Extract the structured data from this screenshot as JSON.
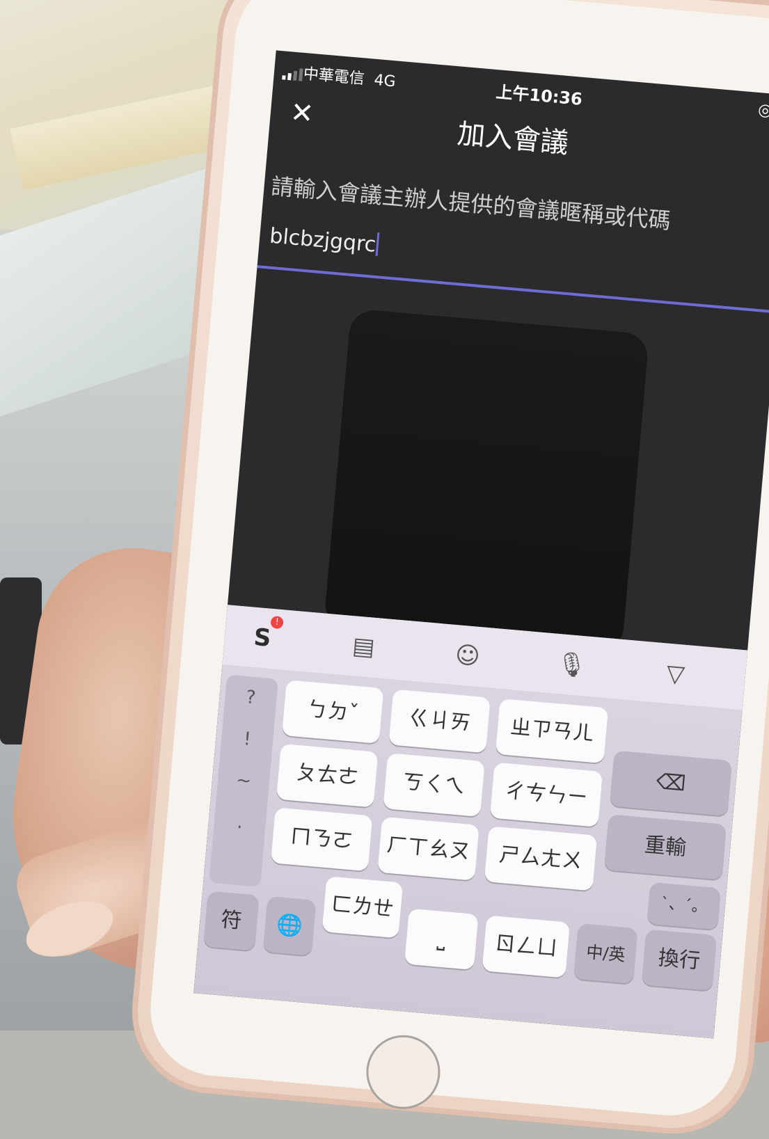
{
  "status_bar": {
    "carrier": "中華電信",
    "network": "4G",
    "time": "上午10:36",
    "right_icons": "◎ ➤"
  },
  "nav": {
    "close_icon": "✕",
    "title": "加入會議"
  },
  "prompt": "請輸入會議主辦人提供的會議暱稱或代碼",
  "meeting_code": {
    "value": "blcbzjgqrc",
    "accent_color": "#6f6cd6"
  },
  "keyboard": {
    "toolbar": {
      "sogou_label": "S",
      "sogou_badge": "!",
      "clipboard_icon": "▤",
      "emoji_icon": "☺",
      "mic_icon": "🎙",
      "collapse_icon": "▽"
    },
    "side_punct": [
      "?",
      "!",
      "~",
      "."
    ],
    "rows": [
      [
        "ㄅㄉˇ",
        "ㄍㄐㄞ",
        "ㄓㄗㄢㄦ"
      ],
      [
        "ㄆㄊㄜ",
        "ㄎㄑㄟ",
        "ㄔㄘㄣㄧ"
      ],
      [
        "ㄇㄋㄛ",
        "ㄏㄒㄠㄡ",
        "ㄕㄙㄤㄨ"
      ],
      [
        "ㄈㄌㄝ",
        "ˊ",
        "ㄖㄥㄩ"
      ]
    ],
    "backspace_icon": "⌫",
    "symbol_key": "符",
    "globe_icon": "🌐",
    "space_key": "⎵",
    "lang_key": "中/英",
    "retype_key": "重輸",
    "punct_key": "ˋ、ˊ。",
    "return_key": "換行"
  }
}
